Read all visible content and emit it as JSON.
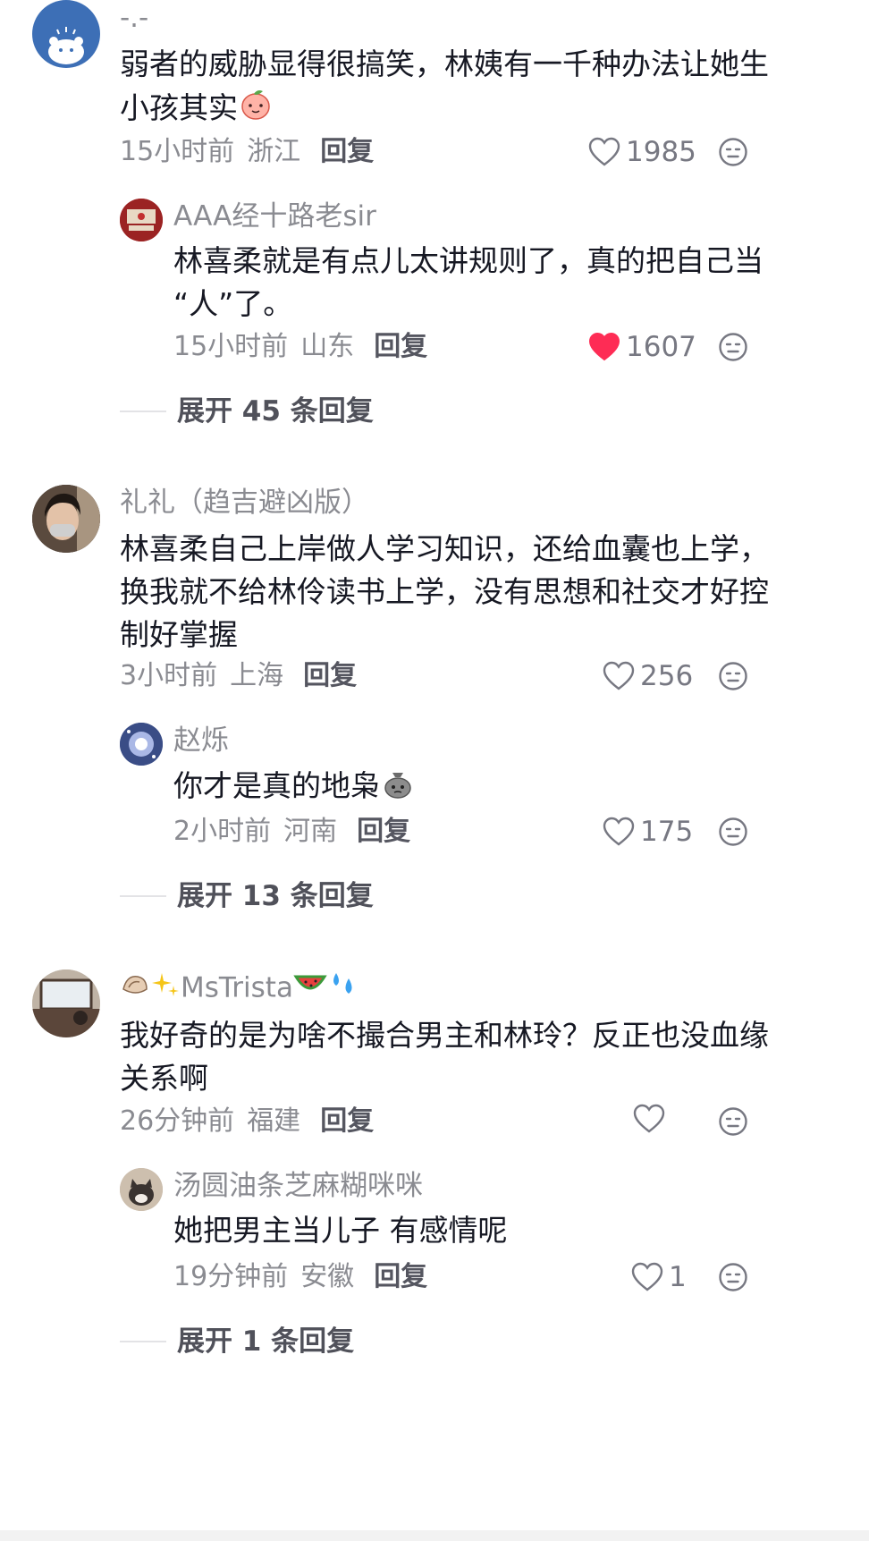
{
  "comments": [
    {
      "username": "-.-",
      "content_line1": "弱者的威胁显得很搞笑，林姨有一千种办法让她生",
      "content_line2": "小孩其实",
      "time": "15小时前",
      "location": "浙江",
      "reply_label": "回复",
      "likes": "1985",
      "liked": false
    },
    {
      "username": "AAA经十路老sir",
      "content_line1": "林喜柔就是有点儿太讲规则了，真的把自己当",
      "content_line2": "“人”了。",
      "time": "15小时前",
      "location": "山东",
      "reply_label": "回复",
      "likes": "1607",
      "liked": true
    },
    {
      "username": "礼礼（趋吉避凶版）",
      "content_line1": "林喜柔自己上岸做人学习知识，还给血囊也上学，",
      "content_line2": "换我就不给林伶读书上学，没有思想和社交才好控",
      "content_line3": "制好掌握",
      "time": "3小时前",
      "location": "上海",
      "reply_label": "回复",
      "likes": "256",
      "liked": false
    },
    {
      "username": "赵烁",
      "content_line1": "你才是真的地枭",
      "time": "2小时前",
      "location": "河南",
      "reply_label": "回复",
      "likes": "175",
      "liked": false
    },
    {
      "username": "MsTrista",
      "content_line1": "我好奇的是为啥不撮合男主和林玲？反正也没血缘",
      "content_line2": "关系啊",
      "time": "26分钟前",
      "location": "福建",
      "reply_label": "回复",
      "likes": "",
      "liked": false
    },
    {
      "username": "汤圆油条芝麻糊咪咪",
      "content_line1": "她把男主当儿子 有感情呢",
      "time": "19分钟前",
      "location": "安徽",
      "reply_label": "回复",
      "likes": "1",
      "liked": false
    }
  ],
  "expand": [
    {
      "label": "展开 45 条回复"
    },
    {
      "label": "展开 13 条回复"
    },
    {
      "label": "展开 1 条回复"
    }
  ],
  "icons": {
    "like": "heart-outline-icon",
    "liked": "heart-filled-icon",
    "dislike": "dislike-face-icon"
  },
  "colors": {
    "liked_red": "#fe2c55",
    "meta_gray": "#8a8b91"
  }
}
